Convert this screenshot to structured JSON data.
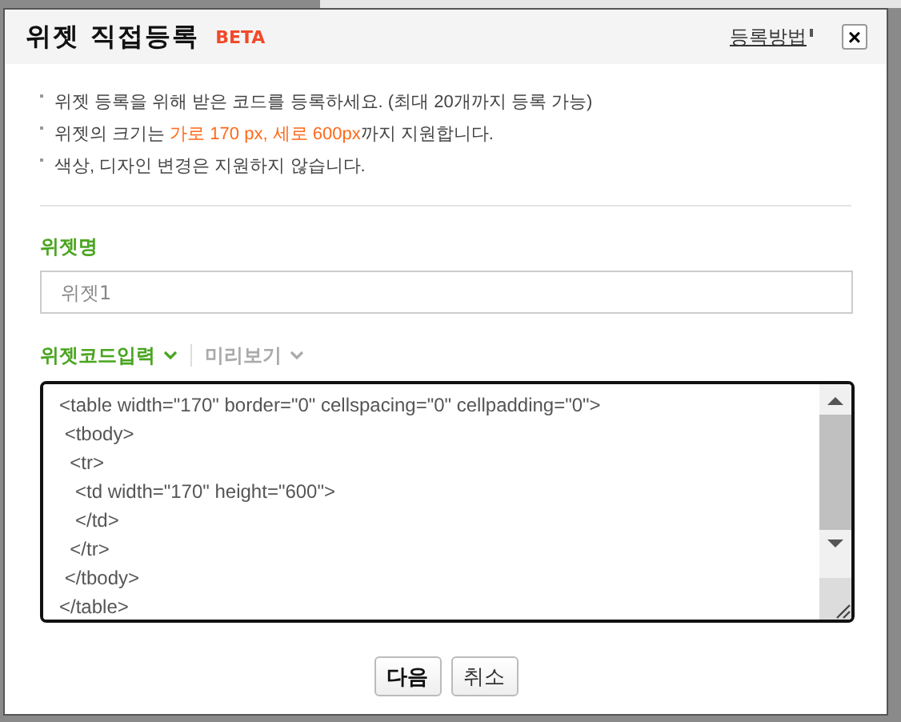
{
  "dialog": {
    "title": "위젯 직접등록",
    "badge": "BETA",
    "help_link": "등록방법",
    "close": "×"
  },
  "notes": [
    {
      "parts": [
        {
          "text": "위젯 등록을 위해 받은 코드를 등록하세요. (최대 20개까지 등록 가능)",
          "highlight": false
        }
      ]
    },
    {
      "parts": [
        {
          "text": "위젯의 크기는 ",
          "highlight": false
        },
        {
          "text": "가로 170 px, 세로 600px",
          "highlight": true
        },
        {
          "text": "까지 지원합니다.",
          "highlight": false
        }
      ]
    },
    {
      "parts": [
        {
          "text": "색상, 디자인 변경은 지원하지 않습니다.",
          "highlight": false
        }
      ]
    }
  ],
  "name_field": {
    "label": "위젯명",
    "placeholder": "위젯1"
  },
  "tabs": [
    {
      "label": "위젯코드입력",
      "selected": true
    },
    {
      "label": "미리보기",
      "selected": false
    }
  ],
  "code": [
    "<table width=\"170\" border=\"0\" cellspacing=\"0\" cellpadding=\"0\">",
    " <tbody>",
    "  <tr>",
    "   <td width=\"170\" height=\"600\">",
    "   </td>",
    "  </tr>",
    " </tbody>",
    "</table>"
  ],
  "buttons": [
    {
      "label": "다음",
      "primary": true
    },
    {
      "label": "취소",
      "primary": false
    }
  ]
}
